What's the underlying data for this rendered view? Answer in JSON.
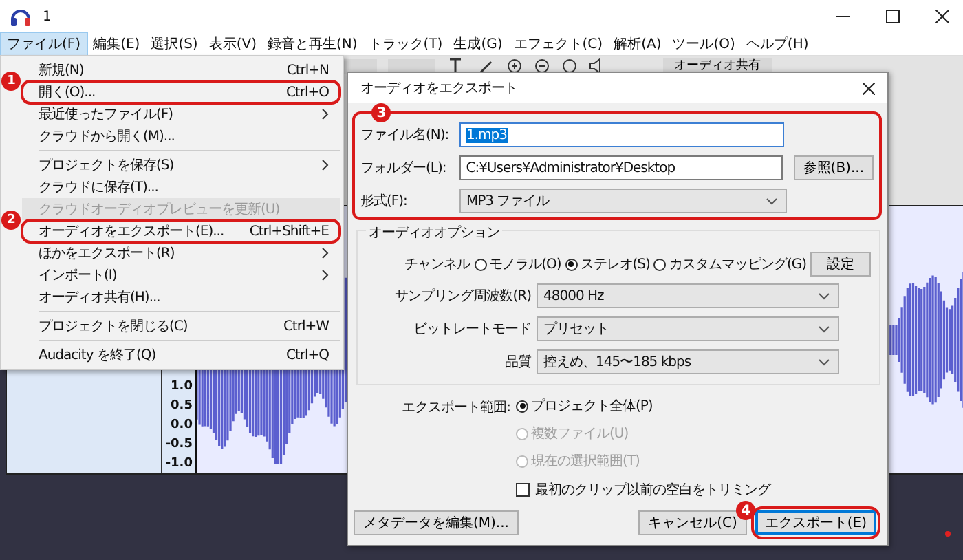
{
  "window": {
    "title": "1"
  },
  "menu_bar": [
    {
      "label": "ファイル(F)",
      "selected": true
    },
    {
      "label": "編集(E)",
      "selected": false
    },
    {
      "label": "選択(S)",
      "selected": false
    },
    {
      "label": "表示(V)",
      "selected": false
    },
    {
      "label": "録音と再生(N)",
      "selected": false
    },
    {
      "label": "トラック(T)",
      "selected": false
    },
    {
      "label": "生成(G)",
      "selected": false
    },
    {
      "label": "エフェクト(C)",
      "selected": false
    },
    {
      "label": "解析(A)",
      "selected": false
    },
    {
      "label": "ツール(O)",
      "selected": false
    },
    {
      "label": "ヘルプ(H)",
      "selected": false
    }
  ],
  "toolbar": {
    "share_button": "オーディオ共有"
  },
  "track": {
    "scale": [
      "1.0",
      "0.5",
      "0.0",
      "-0.5",
      "-1.0"
    ]
  },
  "file_menu": [
    {
      "kind": "item",
      "label": "新規(N)",
      "shortcut": "Ctrl+N",
      "submenu": false,
      "disabled": false
    },
    {
      "kind": "item",
      "label": "開く(O)...",
      "shortcut": "Ctrl+O",
      "submenu": false,
      "disabled": false,
      "callout": "1"
    },
    {
      "kind": "item",
      "label": "最近使ったファイル(F)",
      "submenu": true,
      "disabled": false
    },
    {
      "kind": "item",
      "label": "クラウドから開く(M)...",
      "submenu": false,
      "disabled": false
    },
    {
      "kind": "separator"
    },
    {
      "kind": "item",
      "label": "プロジェクトを保存(S)",
      "submenu": true,
      "disabled": false
    },
    {
      "kind": "item",
      "label": "クラウドに保存(T)...",
      "submenu": false,
      "disabled": false
    },
    {
      "kind": "item",
      "label": "クラウドオーディオプレビューを更新(U)",
      "submenu": false,
      "disabled": true
    },
    {
      "kind": "item",
      "label": "オーディオをエクスポート(E)...",
      "shortcut": "Ctrl+Shift+E",
      "submenu": false,
      "disabled": false,
      "callout": "2"
    },
    {
      "kind": "item",
      "label": "ほかをエクスポート(R)",
      "submenu": true,
      "disabled": false
    },
    {
      "kind": "item",
      "label": "インポート(I)",
      "submenu": true,
      "disabled": false
    },
    {
      "kind": "item",
      "label": "オーディオ共有(H)...",
      "submenu": false,
      "disabled": false
    },
    {
      "kind": "separator"
    },
    {
      "kind": "item",
      "label": "プロジェクトを閉じる(C)",
      "shortcut": "Ctrl+W",
      "submenu": false,
      "disabled": false
    },
    {
      "kind": "separator"
    },
    {
      "kind": "item",
      "label": "Audacity を終了(Q)",
      "shortcut": "Ctrl+Q",
      "submenu": false,
      "disabled": false
    }
  ],
  "dialog": {
    "title": "オーディオをエクスポート",
    "callout": "3",
    "file_name": {
      "label": "ファイル名(N):",
      "value": "1.mp3"
    },
    "folder": {
      "label": "フォルダー(L):",
      "value": "C:¥Users¥Administrator¥Desktop",
      "browse_button": "参照(B)..."
    },
    "format": {
      "label": "形式(F):",
      "value": "MP3 ファイル"
    },
    "audio_options": {
      "title": "オーディオオプション",
      "channel_label": "チャンネル",
      "channels": [
        {
          "label": "モノラル(O)",
          "selected": false
        },
        {
          "label": "ステレオ(S)",
          "selected": true
        },
        {
          "label": "カスタムマッピング(G)",
          "selected": false
        }
      ],
      "settings_button": "設定",
      "dropdowns": [
        {
          "label": "サンプリング周波数(R)",
          "value": "48000 Hz"
        },
        {
          "label": "ビットレートモード",
          "value": "プリセット"
        },
        {
          "label": "品質",
          "value": "控えめ、145〜185 kbps"
        }
      ]
    },
    "export_range": {
      "label": "エクスポート範囲:",
      "options": [
        {
          "label": "プロジェクト全体(P)",
          "selected": true,
          "disabled": false
        },
        {
          "label": "複数ファイル(U)",
          "selected": false,
          "disabled": true
        },
        {
          "label": "現在の選択範囲(T)",
          "selected": false,
          "disabled": true
        }
      ]
    },
    "trim": {
      "label": "最初のクリップ以前の空白をトリミング",
      "checked": false
    },
    "buttons": [
      {
        "kind": "metadata",
        "label": "メタデータを編集(M)..."
      },
      {
        "kind": "cancel",
        "label": "キャンセル(C)"
      },
      {
        "kind": "export",
        "label": "エクスポート(E)",
        "callout": "4"
      }
    ]
  }
}
